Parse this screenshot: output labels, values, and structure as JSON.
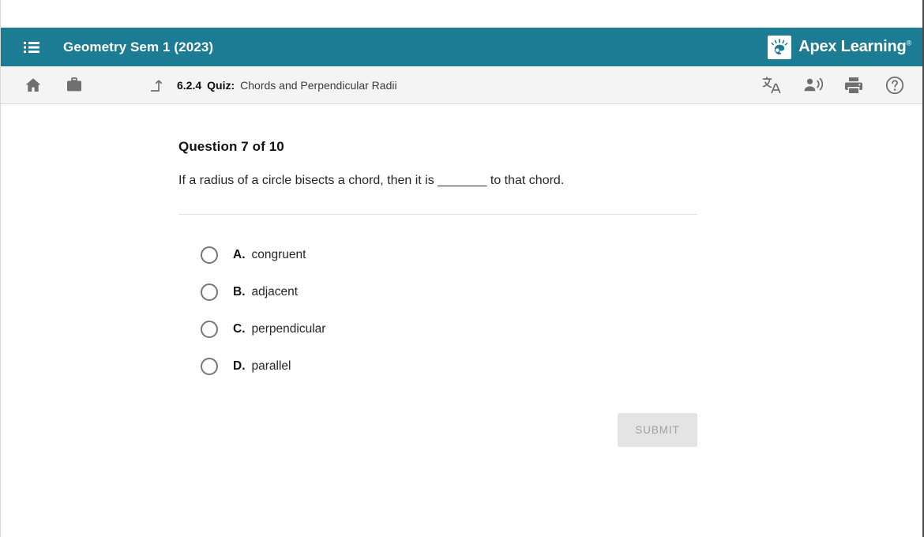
{
  "window": {
    "accent_teal": "#1c7c94",
    "toolbar_bg": "#f4f4f4"
  },
  "appbar": {
    "menu_icon": "list-icon",
    "course_title": "Geometry Sem 1 (2023)",
    "brand_name": "Apex Learning",
    "brand_trademark": "®",
    "brand_logo": "apex-sunburst-logo"
  },
  "toolbar": {
    "home_icon": "home-icon",
    "briefcase_icon": "briefcase-icon",
    "up_level_icon": "subdirectory-arrow-up-icon",
    "breadcrumb": {
      "number": "6.2.4",
      "kind": "Quiz:",
      "name": "Chords and Perpendicular Radii"
    },
    "actions": [
      {
        "name": "translate-icon",
        "label": "Translate"
      },
      {
        "name": "read-aloud-icon",
        "label": "Read aloud"
      },
      {
        "name": "print-icon",
        "label": "Print"
      },
      {
        "name": "help-icon",
        "label": "Help"
      }
    ]
  },
  "question": {
    "heading": "Question 7 of 10",
    "number": 7,
    "total": 10,
    "prompt": "If a radius of a circle bisects a chord, then it is _______ to that chord.",
    "options": [
      {
        "letter": "A.",
        "text": "congruent",
        "selected": false
      },
      {
        "letter": "B.",
        "text": "adjacent",
        "selected": false
      },
      {
        "letter": "C.",
        "text": "perpendicular",
        "selected": false
      },
      {
        "letter": "D.",
        "text": "parallel",
        "selected": false
      }
    ]
  },
  "submit": {
    "label": "SUBMIT",
    "enabled": false
  }
}
